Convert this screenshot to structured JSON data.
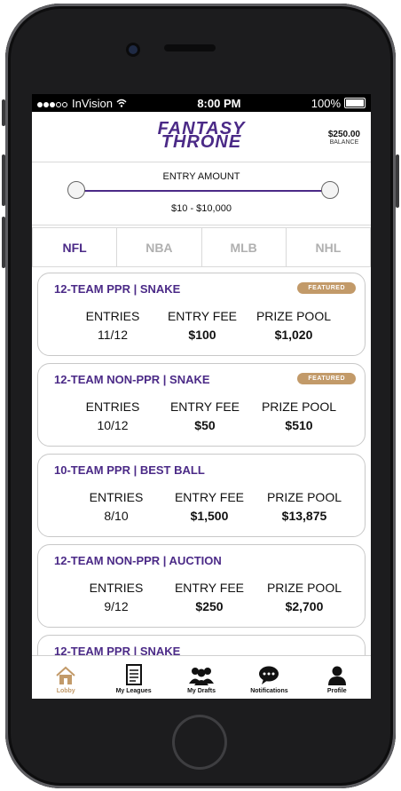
{
  "status_bar": {
    "carrier": "InVision",
    "time": "8:00 PM",
    "battery": "100%"
  },
  "header": {
    "logo_line1": "FANTASY",
    "logo_line2": "THRONE",
    "balance_amount": "$250.00",
    "balance_label": "BALANCE"
  },
  "entry_filter": {
    "title": "ENTRY AMOUNT",
    "range": "$10 - $10,000"
  },
  "sports_tabs": [
    {
      "label": "NFL"
    },
    {
      "label": "NBA"
    },
    {
      "label": "MLB"
    },
    {
      "label": "NHL"
    }
  ],
  "contests": [
    {
      "title": "12-TEAM PPR  |  SNAKE",
      "badge": "FEATURED",
      "entries_label": "ENTRIES",
      "entries": "11/12",
      "fee_label": "ENTRY FEE",
      "fee": "$100",
      "pool_label": "PRIZE POOL",
      "pool": "$1,020"
    },
    {
      "title": "12-TEAM NON-PPR  |  SNAKE",
      "badge": "FEATURED",
      "entries_label": "ENTRIES",
      "entries": "10/12",
      "fee_label": "ENTRY FEE",
      "fee": "$50",
      "pool_label": "PRIZE POOL",
      "pool": "$510"
    },
    {
      "title": "10-TEAM PPR  |  BEST BALL",
      "badge": "",
      "entries_label": "ENTRIES",
      "entries": "8/10",
      "fee_label": "ENTRY FEE",
      "fee": "$1,500",
      "pool_label": "PRIZE POOL",
      "pool": "$13,875"
    },
    {
      "title": "12-TEAM NON-PPR  |  AUCTION",
      "badge": "",
      "entries_label": "ENTRIES",
      "entries": "9/12",
      "fee_label": "ENTRY FEE",
      "fee": "$250",
      "pool_label": "PRIZE POOL",
      "pool": "$2,700"
    },
    {
      "title": "12-TEAM PPR  |  SNAKE",
      "badge": "",
      "entries_label": "",
      "entries": "",
      "fee_label": "",
      "fee": "",
      "pool_label": "",
      "pool": ""
    }
  ],
  "nav": [
    {
      "label": "Lobby",
      "icon": "home-icon",
      "active": true
    },
    {
      "label": "My Leagues",
      "icon": "document-icon",
      "active": false
    },
    {
      "label": "My Drafts",
      "icon": "group-icon",
      "active": false
    },
    {
      "label": "Notifications",
      "icon": "chat-bubble-icon",
      "active": false
    },
    {
      "label": "Profile",
      "icon": "user-icon",
      "active": false
    }
  ],
  "colors": {
    "brand_purple": "#4b2a87",
    "featured_gold": "#c29a69",
    "inactive_tab": "#b0b0b0"
  }
}
